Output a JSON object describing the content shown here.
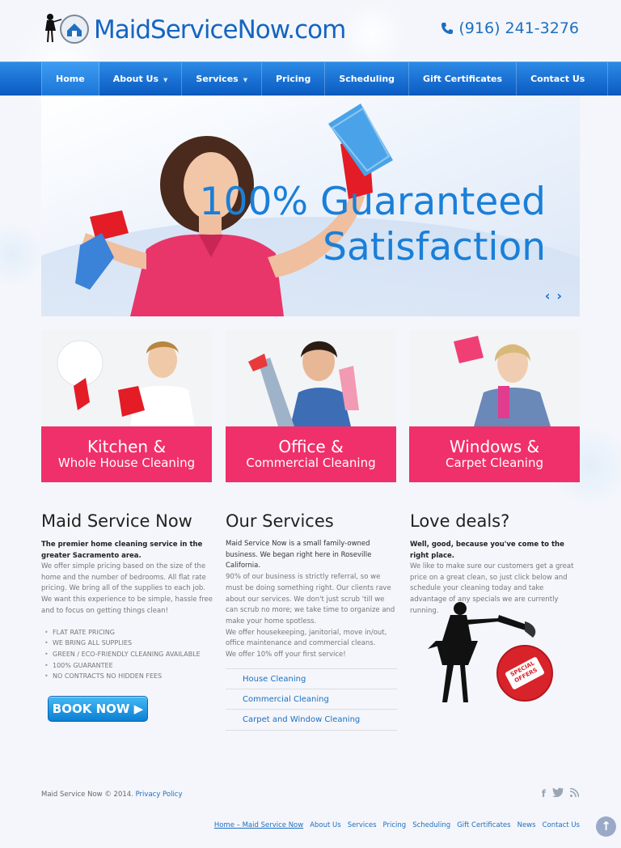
{
  "header": {
    "logo_text": "MaidServiceNow.com",
    "phone": "(916) 241-3276"
  },
  "nav": {
    "items": [
      {
        "label": "Home"
      },
      {
        "label": "About Us"
      },
      {
        "label": "Services"
      },
      {
        "label": "Pricing"
      },
      {
        "label": "Scheduling"
      },
      {
        "label": "Gift Certificates"
      },
      {
        "label": "Contact Us"
      }
    ]
  },
  "slider": {
    "headline_line1": "100% Guaranteed",
    "headline_line2": "Satisfaction",
    "prev": "‹",
    "next": "›"
  },
  "tiles": [
    {
      "line1": "Kitchen &",
      "line2": "Whole House Cleaning"
    },
    {
      "line1": "Office &",
      "line2": "Commercial Cleaning"
    },
    {
      "line1": "Windows &",
      "line2": "Carpet Cleaning"
    }
  ],
  "col1": {
    "title": "Maid Service Now",
    "lead": "The premier home cleaning service in the greater Sacramento area.",
    "body": "We offer simple pricing based on the size of the home and the number of bedrooms. All flat rate pricing. We bring all of the supplies to each job. We want this experience to be simple, hassle free and to focus on getting things clean!",
    "bullets": [
      "FLAT RATE PRICING",
      "WE BRING ALL SUPPLIES",
      "GREEN / ECO-FRIENDLY CLEANING AVAILABLE",
      "100% GUARANTEE",
      "NO CONTRACTS NO HIDDEN FEES"
    ],
    "book_label": "BOOK NOW ▶"
  },
  "col2": {
    "title": "Our Services",
    "p1": "Maid Service Now is a small family-owned business. We began right here in Roseville California.",
    "p2": "90% of our business is strictly referral, so we must be doing something right. Our clients rave about our services. We don't just scrub 'till we can scrub no more; we take time to organize and make your home spotless.",
    "p3": "We offer housekeeping, janitorial, move in/out, office maintenance and commercial cleans.",
    "p4": "We offer 10% off your first service!",
    "links": [
      "House Cleaning",
      "Commercial Cleaning",
      "Carpet and Window Cleaning"
    ]
  },
  "col3": {
    "title": "Love deals?",
    "lead": "Well, good, because you've come to the right place.",
    "body": "We like to make sure our customers get a great price on a great clean, so just click below and schedule your cleaning today and take advantage of any specials we are currently running.",
    "tag_line1": "SPECIAL",
    "tag_line2": "OFFERS"
  },
  "footer": {
    "copyright": "Maid Service Now © 2014.",
    "privacy": "Privacy Policy",
    "social": [
      "f",
      "t",
      "rss"
    ],
    "links": [
      "Home – Maid Service Now",
      "About Us",
      "Services",
      "Pricing",
      "Scheduling",
      "Gift Certificates",
      "News",
      "Contact Us"
    ],
    "to_top": "↑"
  },
  "colors": {
    "brand_blue": "#1565c0",
    "nav_blue": "#0b5cc2",
    "tile_pink": "#f0306b"
  }
}
